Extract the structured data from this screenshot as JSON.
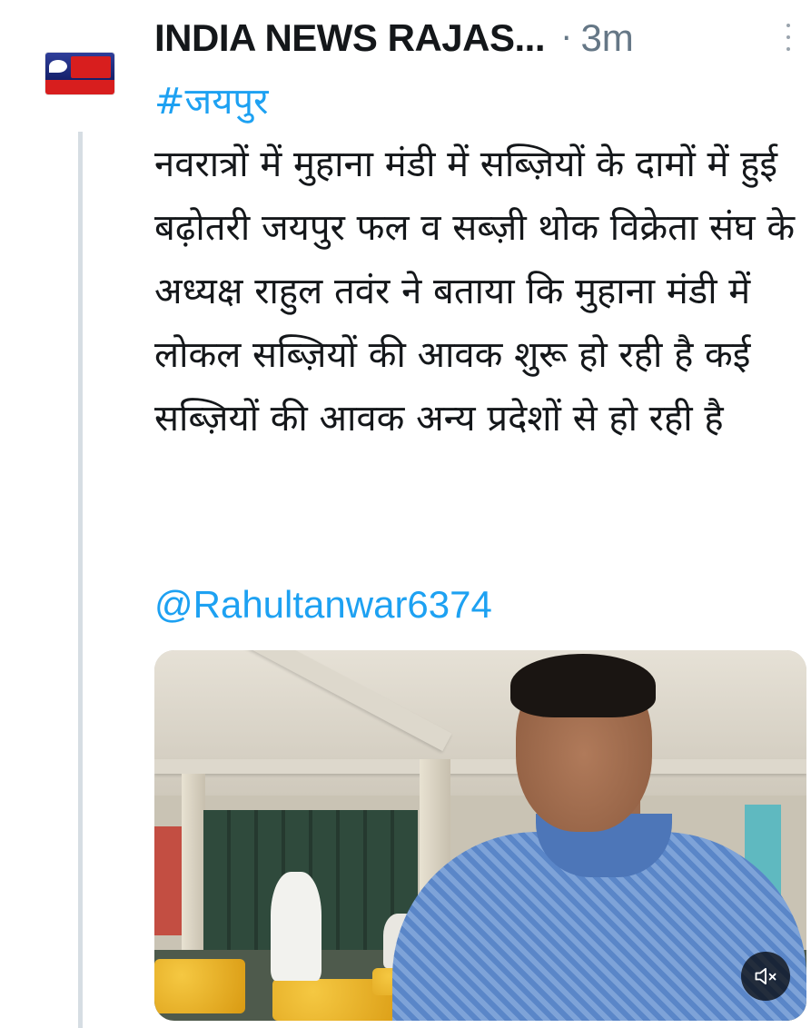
{
  "tweet": {
    "author": "INDIA NEWS RAJAS...",
    "separator": "·",
    "time": "3m",
    "hashtag": "#जयपुर",
    "body": "नवरात्रों में मुहाना मंडी में सब्ज़ियों के दामों में हुई बढ़ोतरी जयपुर फल व सब्ज़ी थोक विक्रेता संघ के अध्यक्ष राहुल तवंर ने बताया कि मुहाना मंडी में लोकल सब्ज़ियों की आवक शुरू हो रही है कई सब्ज़ियों की आवक अन्य प्रदेशों से हो रही है",
    "mention": "@Rahultanwar6374"
  },
  "media": {
    "type": "video",
    "mute_icon": "speaker-muted-icon"
  },
  "colors": {
    "link": "#1da1f2",
    "text": "#14171a",
    "muted": "#657786"
  }
}
